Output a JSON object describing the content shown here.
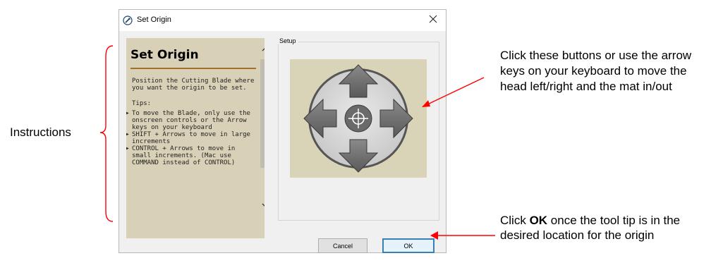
{
  "dialog": {
    "title": "Set Origin",
    "close_label": "✕"
  },
  "instructions_panel": {
    "heading": "Set Origin",
    "intro": "Position the Cutting Blade where you want the origin to be set.",
    "tips_label": "Tips:",
    "tips": [
      "To move the Blade, only use the onscreen controls or the Arrow keys on your keyboard",
      "SHIFT + Arrows to move in large increments",
      "CONTROL + Arrows to move in small increments. (Mac use COMMAND instead of CONTROL)"
    ]
  },
  "setup": {
    "legend": "Setup",
    "icons": [
      "arrow-up-icon",
      "arrow-left-icon",
      "crosshair-icon",
      "arrow-right-icon",
      "arrow-down-icon"
    ]
  },
  "buttons": {
    "cancel": "Cancel",
    "ok": "OK"
  },
  "annotations": {
    "instructions": "Instructions",
    "buttons_note": "Click these buttons or use the arrow keys on your keyboard to move the head left/right and the mat in/out",
    "ok_prefix": "Click ",
    "ok_bold": "OK",
    "ok_suffix": " once the tool tip is in the desired location for the origin"
  },
  "colors": {
    "annotation_arrow": "#ff0000",
    "instruction_panel": "#d9d1b7",
    "heading_rule": "#a0702a",
    "ok_border": "#3c7fb1"
  }
}
